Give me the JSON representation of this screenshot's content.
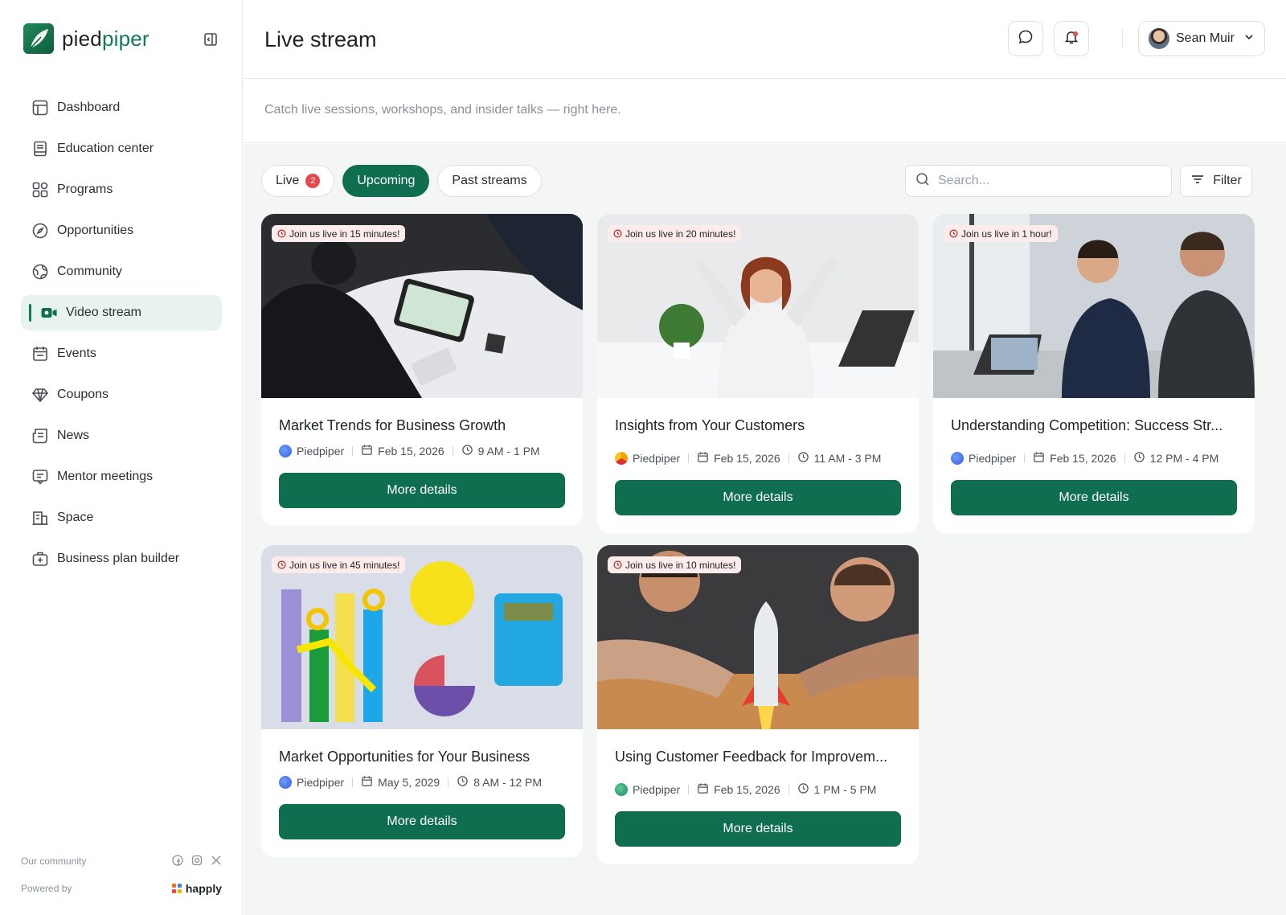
{
  "brand": {
    "name_part1": "pied",
    "name_part2": "piper"
  },
  "nav": [
    {
      "label": "Dashboard",
      "icon": "layout-icon"
    },
    {
      "label": "Education center",
      "icon": "book-icon"
    },
    {
      "label": "Programs",
      "icon": "grid-icon"
    },
    {
      "label": "Opportunities",
      "icon": "compass-icon"
    },
    {
      "label": "Community",
      "icon": "globe-icon"
    },
    {
      "label": "Video stream",
      "icon": "video-icon",
      "active": true
    },
    {
      "label": "Events",
      "icon": "calendar-icon"
    },
    {
      "label": "Coupons",
      "icon": "diamond-icon"
    },
    {
      "label": "News",
      "icon": "news-icon"
    },
    {
      "label": "Mentor meetings",
      "icon": "chat-icon"
    },
    {
      "label": "Space",
      "icon": "building-icon"
    },
    {
      "label": "Business plan builder",
      "icon": "briefcase-icon"
    }
  ],
  "footer": {
    "community_label": "Our community",
    "powered_label": "Powered by",
    "powered_brand": "happly"
  },
  "header": {
    "title": "Live stream",
    "user_name": "Sean Muir"
  },
  "subtitle": "Catch live sessions, workshops, and insider talks — right here.",
  "tabs": [
    {
      "label": "Live",
      "badge": "2"
    },
    {
      "label": "Upcoming",
      "active": true
    },
    {
      "label": "Past streams"
    }
  ],
  "search": {
    "placeholder": "Search..."
  },
  "filter_label": "Filter",
  "more_label": "More details",
  "cards": [
    {
      "countdown": "Join us live in 15 minutes!",
      "title": "Market Trends for Business Growth",
      "org": "Piedpiper",
      "date": "Feb 15, 2026",
      "time": "9 AM - 1 PM"
    },
    {
      "countdown": "Join us live in 20 minutes!",
      "title": "Insights from Your Customers",
      "org": "Piedpiper",
      "date": "Feb 15, 2026",
      "time": "11 AM - 3 PM"
    },
    {
      "countdown": "Join us live in 1 hour!",
      "title": "Understanding Competition: Success Str...",
      "org": "Piedpiper",
      "date": "Feb 15, 2026",
      "time": "12 PM - 4 PM"
    },
    {
      "countdown": "Join us live in 45 minutes!",
      "title": "Market Opportunities for Your Business",
      "org": "Piedpiper",
      "date": "May 5, 2029",
      "time": "8 AM - 12 PM"
    },
    {
      "countdown": "Join us live in 10 minutes!",
      "title": "Using Customer Feedback for Improvem...",
      "org": "Piedpiper",
      "date": "Feb 15, 2026",
      "time": "1 PM - 5 PM"
    }
  ]
}
